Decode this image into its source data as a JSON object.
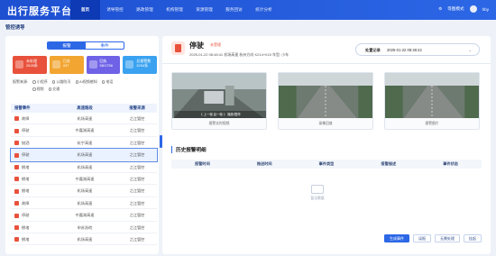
{
  "app": {
    "title": "出行服务平台"
  },
  "nav": {
    "items": [
      "首页",
      "诱导管控",
      "路政管理",
      "机构管理",
      "资源管理",
      "服务回访",
      "统计分析"
    ],
    "active": 0
  },
  "user": {
    "mode": "等图模式",
    "name": "hby"
  },
  "breadcrumb": "管控诱导",
  "tabs": {
    "left": "报警",
    "right": "事件"
  },
  "cards": [
    {
      "label": "未处理",
      "value": "2628条",
      "color": "#e8513b"
    },
    {
      "label": "已处",
      "value": "437",
      "color": "#f2a531"
    },
    {
      "label": "回执",
      "value": "58/1756",
      "color": "#6f62e7"
    },
    {
      "label": "总报警数",
      "value": "3254条",
      "color": "#3aa2f0"
    }
  ],
  "filters": {
    "label": "报警来源:",
    "options": [
      "小程序",
      "视频",
      "公路防汛",
      "AI视频感知",
      "电话"
    ],
    "extra": "交通"
  },
  "table": {
    "headers": [
      "报警事件",
      "高速路段",
      "报警来源"
    ],
    "rows": [
      {
        "event": "故障",
        "road": "机场高速",
        "source": "之江管控"
      },
      {
        "event": "停驶",
        "road": "中嘉湖高速",
        "source": "之江管控"
      },
      {
        "event": "抛洒",
        "road": "杭宁高速",
        "source": "之江管控"
      },
      {
        "event": "停驶",
        "road": "机场高速",
        "source": "之江管控"
      },
      {
        "event": "拥堵",
        "road": "机场高速",
        "source": "之江管控"
      },
      {
        "event": "拥堵",
        "road": "中嘉湖高速",
        "source": "之江管控"
      },
      {
        "event": "拥堵",
        "road": "机场高速",
        "source": "之江管控"
      },
      {
        "event": "故障",
        "road": "机场高速",
        "source": "之江管控"
      },
      {
        "event": "停驶",
        "road": "中嘉湖高速",
        "source": "之江管控"
      },
      {
        "event": "拥堵",
        "road": "申苏浙皖",
        "source": "之江管控"
      },
      {
        "event": "拥堵",
        "road": "机场高速",
        "source": "之江管控"
      }
    ]
  },
  "event": {
    "title": "停驶",
    "status": "未受理",
    "subtitle": "2025-01-22 08:48:41  机场高速 杭州方向 K214+015 车型: 小车"
  },
  "process": {
    "label": "处置记录",
    "time": "2025-01-22 08:48:42"
  },
  "images": [
    {
      "caption": "报警实时视频",
      "toolbar": "《 上一帧  后一帧 》 播放/暂停"
    },
    {
      "caption": "录像回放",
      "toolbar": ""
    },
    {
      "caption": "报警图片",
      "toolbar": ""
    }
  ],
  "history": {
    "title": "历史报警明细",
    "headers": [
      "报警时间",
      "推送时间",
      "事件类型",
      "报警描述",
      "事件状态"
    ],
    "empty": "暂无数据"
  },
  "buttons": [
    "生成事件",
    "误报",
    "无需处理",
    "挂起"
  ],
  "colors": {
    "primary": "#2c67e6",
    "danger": "#e8513b"
  }
}
